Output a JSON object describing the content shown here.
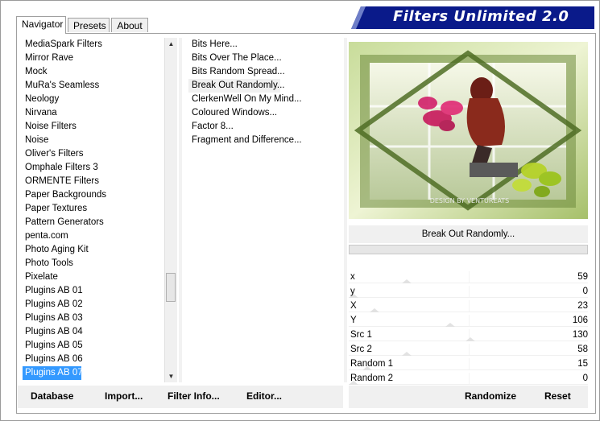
{
  "tabs": [
    "Navigator",
    "Presets",
    "About"
  ],
  "banner": {
    "title": "Filters Unlimited 2.0",
    "color": "#0a1a8a"
  },
  "categories": [
    "MediaSpark Filters",
    "Mirror Rave",
    "Mock",
    "MuRa's Seamless",
    "Neology",
    "Nirvana",
    "Noise Filters",
    "Noise",
    "Oliver's Filters",
    "Omphale Filters 3",
    "ORMENTE Filters",
    "Paper Backgrounds",
    "Paper Textures",
    "Pattern Generators",
    "penta.com",
    "Photo Aging Kit",
    "Photo Tools",
    "Pixelate",
    "Plugins AB 01",
    "Plugins AB 02",
    "Plugins AB 03",
    "Plugins AB 04",
    "Plugins AB 05",
    "Plugins AB 06",
    "Plugins AB 07"
  ],
  "selected_category": "Plugins AB 07",
  "filters": [
    "Bits Here...",
    "Bits Over The Place...",
    "Bits Random Spread...",
    "Break Out Randomly...",
    "ClerkenWell On My Mind...",
    "Coloured Windows...",
    "Factor 8...",
    "Fragment and Difference..."
  ],
  "selected_filter": "Break Out Randomly...",
  "preview": {
    "watermark": "DESIGN BY VENTUREATS"
  },
  "params": [
    {
      "name": "x",
      "value": "59",
      "level": 0.23
    },
    {
      "name": "y",
      "value": "0",
      "level": 0.0
    },
    {
      "name": "X",
      "value": "23",
      "level": 0.09
    },
    {
      "name": "Y",
      "value": "106",
      "level": 0.42
    },
    {
      "name": "Src 1",
      "value": "130",
      "level": 0.51
    },
    {
      "name": "Src 2",
      "value": "58",
      "level": 0.23
    },
    {
      "name": "Random 1",
      "value": "15",
      "level": 0.06
    },
    {
      "name": "Random 2",
      "value": "0",
      "level": 0.0
    }
  ],
  "buttons": {
    "database": "Database",
    "import": "Import...",
    "filter_info": "Filter Info...",
    "editor": "Editor...",
    "randomize": "Randomize",
    "reset": "Reset"
  }
}
